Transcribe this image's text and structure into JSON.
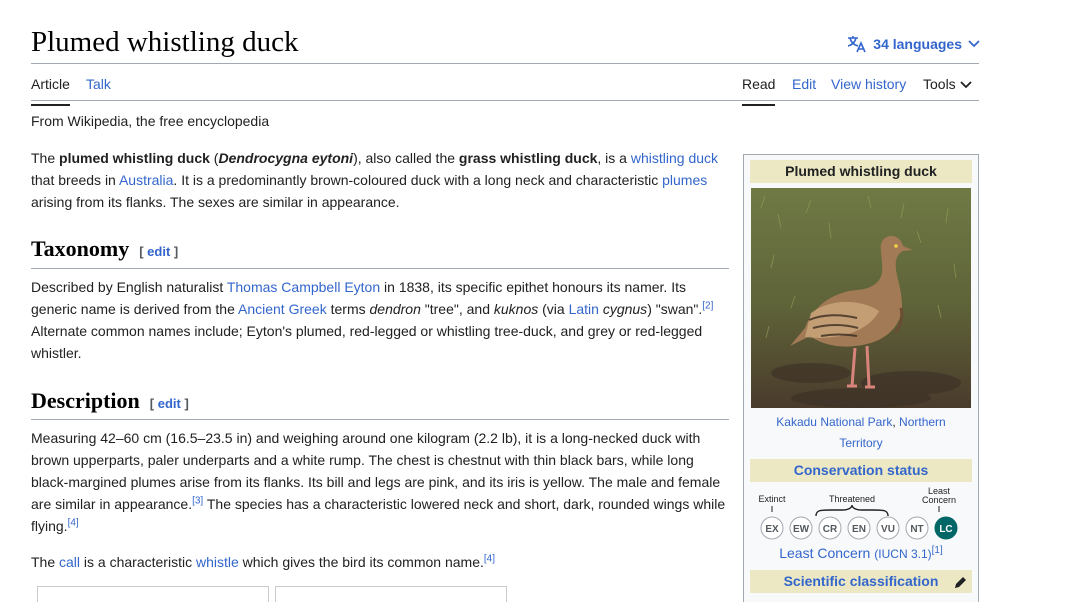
{
  "header": {
    "title": "Plumed whistling duck",
    "languages": "34 languages"
  },
  "tabs": {
    "article": "Article",
    "talk": "Talk",
    "read": "Read",
    "edit": "Edit",
    "history": "View history",
    "tools": "Tools"
  },
  "tagline": "From Wikipedia, the free encyclopedia",
  "intro": {
    "t1": "The ",
    "b1": "plumed whistling duck",
    "t2": " (",
    "bi1": "Dendrocygna eytoni",
    "t3": "), also called the ",
    "b2": "grass whistling duck",
    "t4": ", is a ",
    "l1": "whistling duck",
    "t5": " that breeds in ",
    "l2": "Australia",
    "t6": ". It is a predominantly brown-coloured duck with a long neck and characteristic ",
    "l3": "plumes",
    "t7": " arising from its flanks. The sexes are similar in appearance."
  },
  "taxonomy": {
    "heading": "Taxonomy",
    "edit": "edit",
    "t1": "Described by English naturalist ",
    "l1": "Thomas Campbell Eyton",
    "t2": " in 1838, its specific epithet honours its namer. Its generic name is derived from the ",
    "l2": "Ancient Greek",
    "t3": " terms ",
    "i1": "dendron",
    "t4": " \"tree\", and ",
    "i2": "kuknos",
    "t5": " (via ",
    "l3": "Latin",
    "t6": " ",
    "i3": "cygnus",
    "t7": ") \"swan\".",
    "ref": "[2]",
    "t8": " Alternate common names include; Eyton's plumed, red-legged or whistling tree-duck, and grey or red-legged whistler."
  },
  "description": {
    "heading": "Description",
    "edit": "edit",
    "t1": "Measuring 42–60 cm (16.5–23.5 in) and weighing around one kilogram (2.2 lb), it is a long-necked duck with brown upperparts, paler underparts and a white rump. The chest is chestnut with thin black bars, while long black-margined plumes arise from its flanks. Its bill and legs are pink, and its iris is yellow. The male and female are similar in appearance.",
    "ref1": "[3]",
    "t2": " The species has a characteristic lowered neck and short, dark, rounded wings while flying.",
    "ref2": "[4]",
    "call_t1": "The ",
    "call_l1": "call",
    "call_t2": " is a characteristic ",
    "call_l2": "whistle",
    "call_t3": " which gives the bird its common name.",
    "call_ref": "[4]"
  },
  "infobox": {
    "title": "Plumed whistling duck",
    "caption_link1": "Kakadu National Park",
    "caption_sep": ", ",
    "caption_link2": "Northern Territory",
    "conservation": "Conservation status",
    "scale_extinct": "Extinct",
    "scale_threatened": "Threatened",
    "scale_least1": "Least",
    "scale_least2": "Concern",
    "codes": [
      "EX",
      "EW",
      "CR",
      "EN",
      "VU",
      "NT",
      "LC"
    ],
    "status": "Least Concern",
    "iucn": "(IUCN 3.1)",
    "iucn_ref": "[1]",
    "sci": "Scientific classification"
  },
  "colors": {
    "link": "#3366cc",
    "infobox_header": "#ece8c4",
    "lc_green": "#006666"
  }
}
